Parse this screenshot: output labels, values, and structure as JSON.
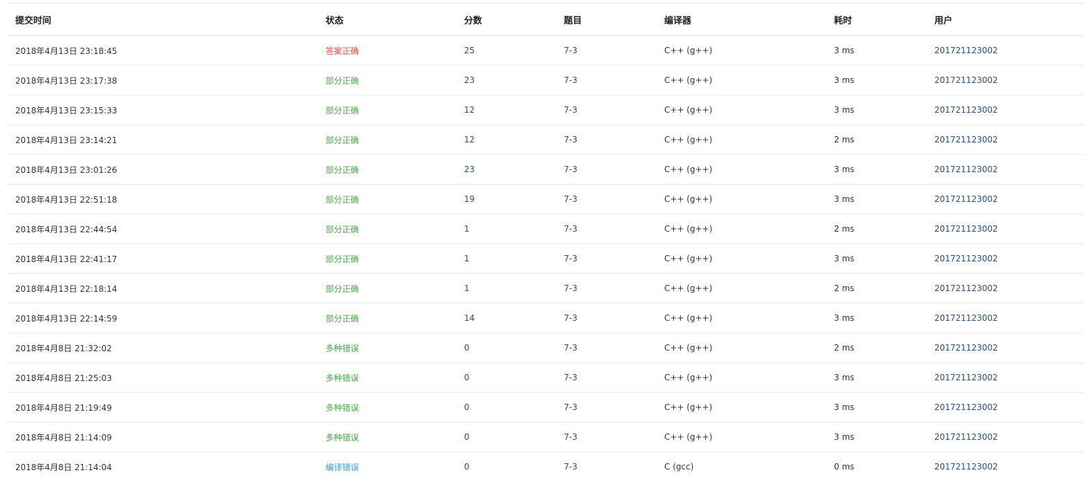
{
  "colors": {
    "accepted": "#e34a4a",
    "partial": "#4aa54a",
    "multiple_errors": "#4aa54a",
    "compile_error": "#2f9fd8",
    "link": "#2a4d7a"
  },
  "table": {
    "headers": {
      "time": "提交时间",
      "status": "状态",
      "score": "分数",
      "problem": "题目",
      "compiler": "编译器",
      "duration": "耗时",
      "user": "用户"
    },
    "rows": [
      {
        "time": "2018年4月13日 23:18:45",
        "status": "答案正确",
        "status_type": "accepted",
        "score": "25",
        "problem": "7-3",
        "compiler": "C++ (g++)",
        "duration": "3 ms",
        "user": "201721123002"
      },
      {
        "time": "2018年4月13日 23:17:38",
        "status": "部分正确",
        "status_type": "partial",
        "score": "23",
        "problem": "7-3",
        "compiler": "C++ (g++)",
        "duration": "3 ms",
        "user": "201721123002"
      },
      {
        "time": "2018年4月13日 23:15:33",
        "status": "部分正确",
        "status_type": "partial",
        "score": "12",
        "problem": "7-3",
        "compiler": "C++ (g++)",
        "duration": "3 ms",
        "user": "201721123002"
      },
      {
        "time": "2018年4月13日 23:14:21",
        "status": "部分正确",
        "status_type": "partial",
        "score": "12",
        "problem": "7-3",
        "compiler": "C++ (g++)",
        "duration": "2 ms",
        "user": "201721123002"
      },
      {
        "time": "2018年4月13日 23:01:26",
        "status": "部分正确",
        "status_type": "partial",
        "score": "23",
        "problem": "7-3",
        "compiler": "C++ (g++)",
        "duration": "3 ms",
        "user": "201721123002"
      },
      {
        "time": "2018年4月13日 22:51:18",
        "status": "部分正确",
        "status_type": "partial",
        "score": "19",
        "problem": "7-3",
        "compiler": "C++ (g++)",
        "duration": "3 ms",
        "user": "201721123002"
      },
      {
        "time": "2018年4月13日 22:44:54",
        "status": "部分正确",
        "status_type": "partial",
        "score": "1",
        "problem": "7-3",
        "compiler": "C++ (g++)",
        "duration": "2 ms",
        "user": "201721123002"
      },
      {
        "time": "2018年4月13日 22:41:17",
        "status": "部分正确",
        "status_type": "partial",
        "score": "1",
        "problem": "7-3",
        "compiler": "C++ (g++)",
        "duration": "3 ms",
        "user": "201721123002"
      },
      {
        "time": "2018年4月13日 22:18:14",
        "status": "部分正确",
        "status_type": "partial",
        "score": "1",
        "problem": "7-3",
        "compiler": "C++ (g++)",
        "duration": "2 ms",
        "user": "201721123002"
      },
      {
        "time": "2018年4月13日 22:14:59",
        "status": "部分正确",
        "status_type": "partial",
        "score": "14",
        "problem": "7-3",
        "compiler": "C++ (g++)",
        "duration": "3 ms",
        "user": "201721123002"
      },
      {
        "time": "2018年4月8日 21:32:02",
        "status": "多种错误",
        "status_type": "multi",
        "score": "0",
        "problem": "7-3",
        "compiler": "C++ (g++)",
        "duration": "2 ms",
        "user": "201721123002"
      },
      {
        "time": "2018年4月8日 21:25:03",
        "status": "多种错误",
        "status_type": "multi",
        "score": "0",
        "problem": "7-3",
        "compiler": "C++ (g++)",
        "duration": "3 ms",
        "user": "201721123002"
      },
      {
        "time": "2018年4月8日 21:19:49",
        "status": "多种错误",
        "status_type": "multi",
        "score": "0",
        "problem": "7-3",
        "compiler": "C++ (g++)",
        "duration": "3 ms",
        "user": "201721123002"
      },
      {
        "time": "2018年4月8日 21:14:09",
        "status": "多种错误",
        "status_type": "multi",
        "score": "0",
        "problem": "7-3",
        "compiler": "C++ (g++)",
        "duration": "3 ms",
        "user": "201721123002"
      },
      {
        "time": "2018年4月8日 21:14:04",
        "status": "编译错误",
        "status_type": "compile",
        "score": "0",
        "problem": "7-3",
        "compiler": "C (gcc)",
        "duration": "0 ms",
        "user": "201721123002"
      }
    ]
  }
}
